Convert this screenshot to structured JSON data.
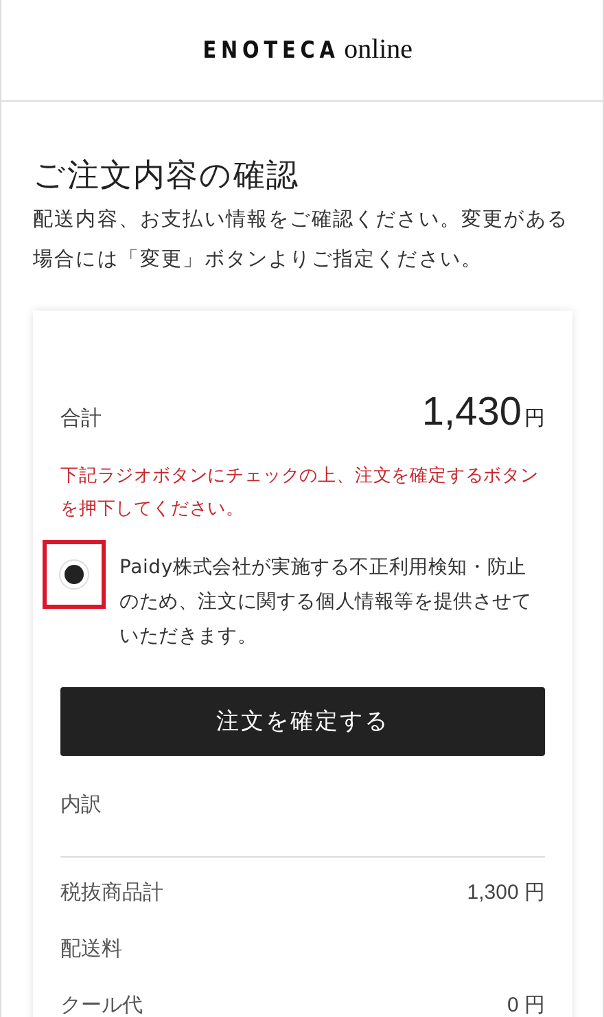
{
  "header": {
    "logo": {
      "brand": "ENOTECA",
      "suffix": "online"
    }
  },
  "title": "ご注文内容の確認",
  "description": "配送内容、お支払い情報をご確認ください。変更がある場合には「変更」ボタンよりご指定ください。",
  "summary": {
    "total_label": "合計",
    "total_amount": "1,430",
    "total_currency": "円",
    "notice": "下記ラジオボタンにチェックの上、注文を確定するボタンを押下してください。",
    "consent": {
      "checked": true,
      "highlighted": true,
      "text": "Paidy株式会社が実施する不正利用検知・防止のため、注文に関する個人情報等を提供させていただきます。"
    },
    "confirm_button": "注文を確定する",
    "breakdown_label": "内訳",
    "rows": [
      {
        "label": "税抜商品計",
        "value": "1,300 円"
      },
      {
        "label": "配送料"
      },
      {
        "label": "クール代",
        "value": "0 円"
      }
    ]
  }
}
